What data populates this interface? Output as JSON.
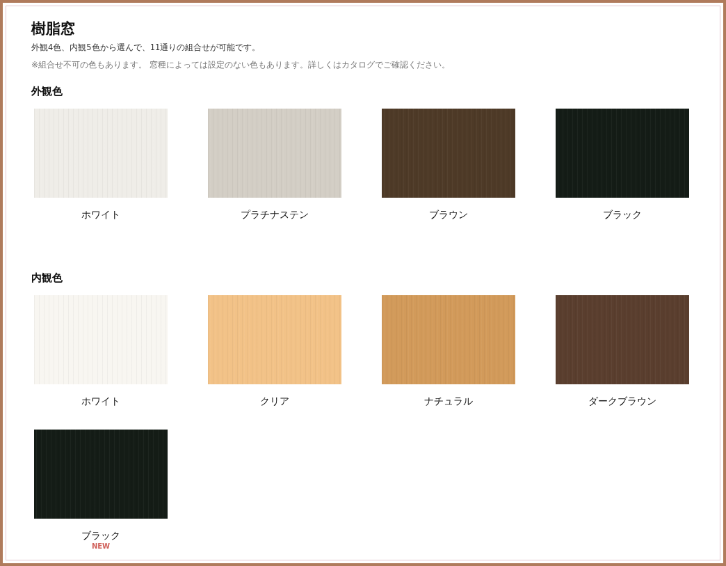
{
  "title": "樹脂窓",
  "subtitle": "外観4色、内観5色から選んで、11通りの組合せが可能です。",
  "note": "※組合せ不可の色もあります。 窓種によっては設定のない色もあります。詳しくはカタログでご確認ください。",
  "sections": [
    {
      "heading": "外観色",
      "colors": [
        {
          "name": "ホワイト",
          "color": "#efede8"
        },
        {
          "name": "プラチナステン",
          "color": "#d3cec5"
        },
        {
          "name": "ブラウン",
          "color": "#4e3a27"
        },
        {
          "name": "ブラック",
          "color": "#141c16"
        }
      ]
    },
    {
      "heading": "内観色",
      "colors": [
        {
          "name": "ホワイト",
          "color": "#f8f6f1"
        },
        {
          "name": "クリア",
          "color": "#f2c287"
        },
        {
          "name": "ナチュラル",
          "color": "#d29a5a"
        },
        {
          "name": "ダークブラウン",
          "color": "#5a3e2e"
        },
        {
          "name": "ブラック",
          "color": "#141c16",
          "badge": "NEW"
        }
      ]
    }
  ]
}
